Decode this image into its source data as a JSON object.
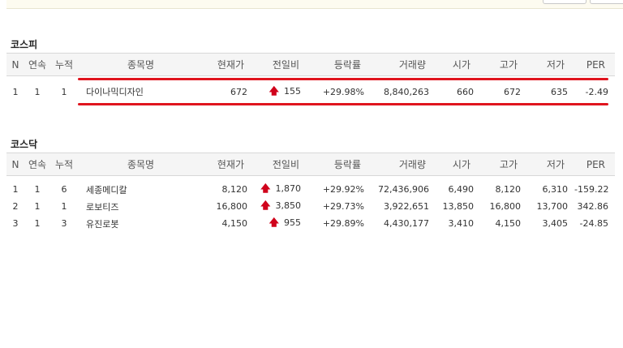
{
  "headers": [
    "N",
    "연속",
    "누적",
    "종목명",
    "현재가",
    "전일비",
    "등락률",
    "거래량",
    "시가",
    "고가",
    "저가",
    "PER"
  ],
  "kospi": {
    "title": "코스피",
    "rows": [
      {
        "n": "1",
        "streak": "1",
        "total": "1",
        "name": "다이나믹디자인",
        "price": "672",
        "change": "155",
        "rate": "+29.98%",
        "volume": "8,840,263",
        "open": "660",
        "high": "672",
        "low": "635",
        "per": "-2.49"
      }
    ]
  },
  "kosdaq": {
    "title": "코스닥",
    "rows": [
      {
        "n": "1",
        "streak": "1",
        "total": "6",
        "name": "세종메디칼",
        "price": "8,120",
        "change": "1,870",
        "rate": "+29.92%",
        "volume": "72,436,906",
        "open": "6,490",
        "high": "8,120",
        "low": "6,310",
        "per": "-159.22"
      },
      {
        "n": "2",
        "streak": "1",
        "total": "1",
        "name": "로보티즈",
        "price": "16,800",
        "change": "3,850",
        "rate": "+29.73%",
        "volume": "3,922,651",
        "open": "13,850",
        "high": "16,800",
        "low": "13,700",
        "per": "342.86"
      },
      {
        "n": "3",
        "streak": "1",
        "total": "3",
        "name": "유진로봇",
        "price": "4,150",
        "change": "955",
        "rate": "+29.89%",
        "volume": "4,430,177",
        "open": "3,410",
        "high": "4,150",
        "low": "3,405",
        "per": "-24.85"
      }
    ]
  },
  "colors": {
    "up": "#d0021b",
    "annotation": "#e0141e",
    "header_bg": "#f5f5f5"
  },
  "icons": {
    "up_arrow": "up-arrow-icon"
  }
}
